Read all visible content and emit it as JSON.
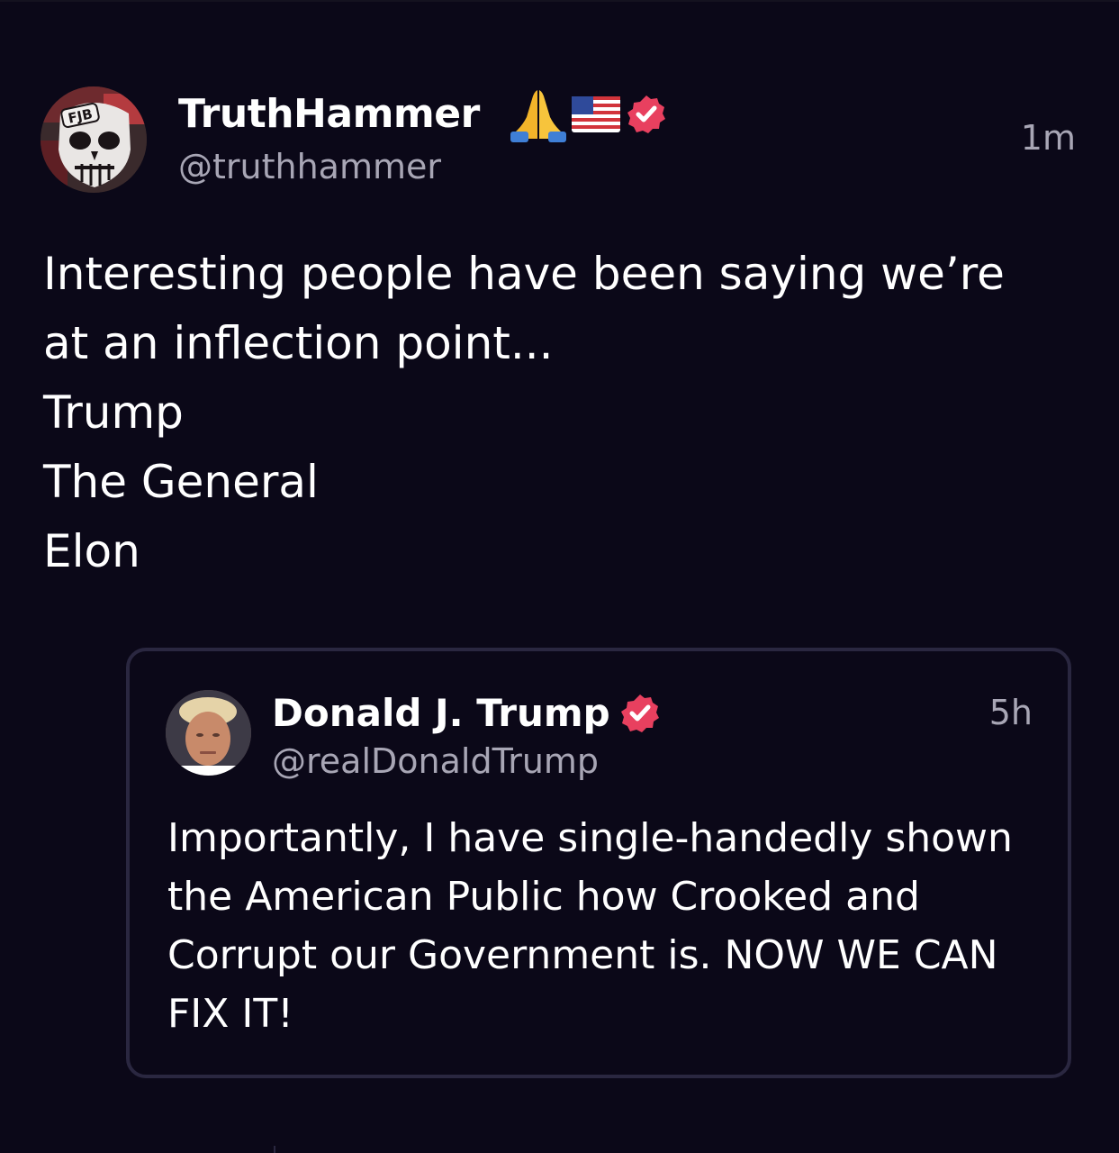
{
  "post": {
    "author": {
      "display_name": "TruthHammer",
      "handle": "@truthhammer",
      "avatar_text": "FJB",
      "badges": [
        "praying-hands-icon",
        "us-flag-icon",
        "verified-badge-icon"
      ]
    },
    "timestamp": "1m",
    "text_lines": [
      "Interesting people have been saying we’re",
      "at an inflection point...",
      "Trump",
      "The General",
      "Elon"
    ]
  },
  "quoted_post": {
    "author": {
      "display_name": "Donald J. Trump",
      "handle": "@realDonaldTrump",
      "badges": [
        "verified-badge-icon"
      ]
    },
    "timestamp": "5h",
    "text": "Importantly, I have single-handedly shown the American Public how Crooked and Corrupt our Government is. NOW WE CAN FIX IT!"
  },
  "colors": {
    "background": "#0b0818",
    "primary_text": "#ffffff",
    "secondary_text": "#a8a6b5",
    "verified_badge": "#e8405f",
    "card_border": "#2a2740"
  }
}
